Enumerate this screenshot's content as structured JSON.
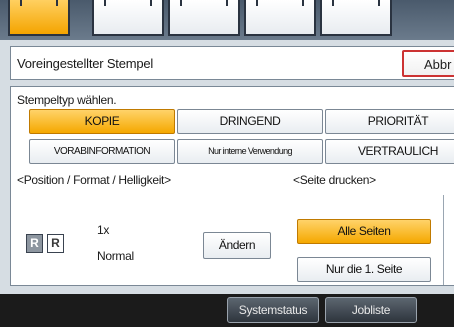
{
  "header": {
    "title": "Voreingestellter Stempel",
    "cancel_label": "Abbr"
  },
  "stamp_type": {
    "label": "Stempeltyp wählen.",
    "options": [
      {
        "label": "KOPIE",
        "selected": true
      },
      {
        "label": "DRINGEND",
        "selected": false
      },
      {
        "label": "PRIORITÄT",
        "selected": false
      },
      {
        "label": "VORABINFORMATION",
        "selected": false
      },
      {
        "label": "Nur interne Verwendung",
        "selected": false
      },
      {
        "label": "VERTRAULICH",
        "selected": false
      }
    ]
  },
  "position_format": {
    "label": "<Position / Format / Helligkeit>",
    "icon_letter": "R",
    "size": "1x",
    "density": "Normal",
    "change_label": "Ändern"
  },
  "print_pages": {
    "label": "<Seite drucken>",
    "options": [
      {
        "label": "Alle Seiten",
        "selected": true
      },
      {
        "label": "Nur die 1. Seite",
        "selected": false
      }
    ]
  },
  "bottom_bar": {
    "system_status_label": "Systemstatus",
    "job_list_label": "Jobliste"
  },
  "colors": {
    "selected": "#f5a800",
    "cancel_border": "#cc3333"
  }
}
